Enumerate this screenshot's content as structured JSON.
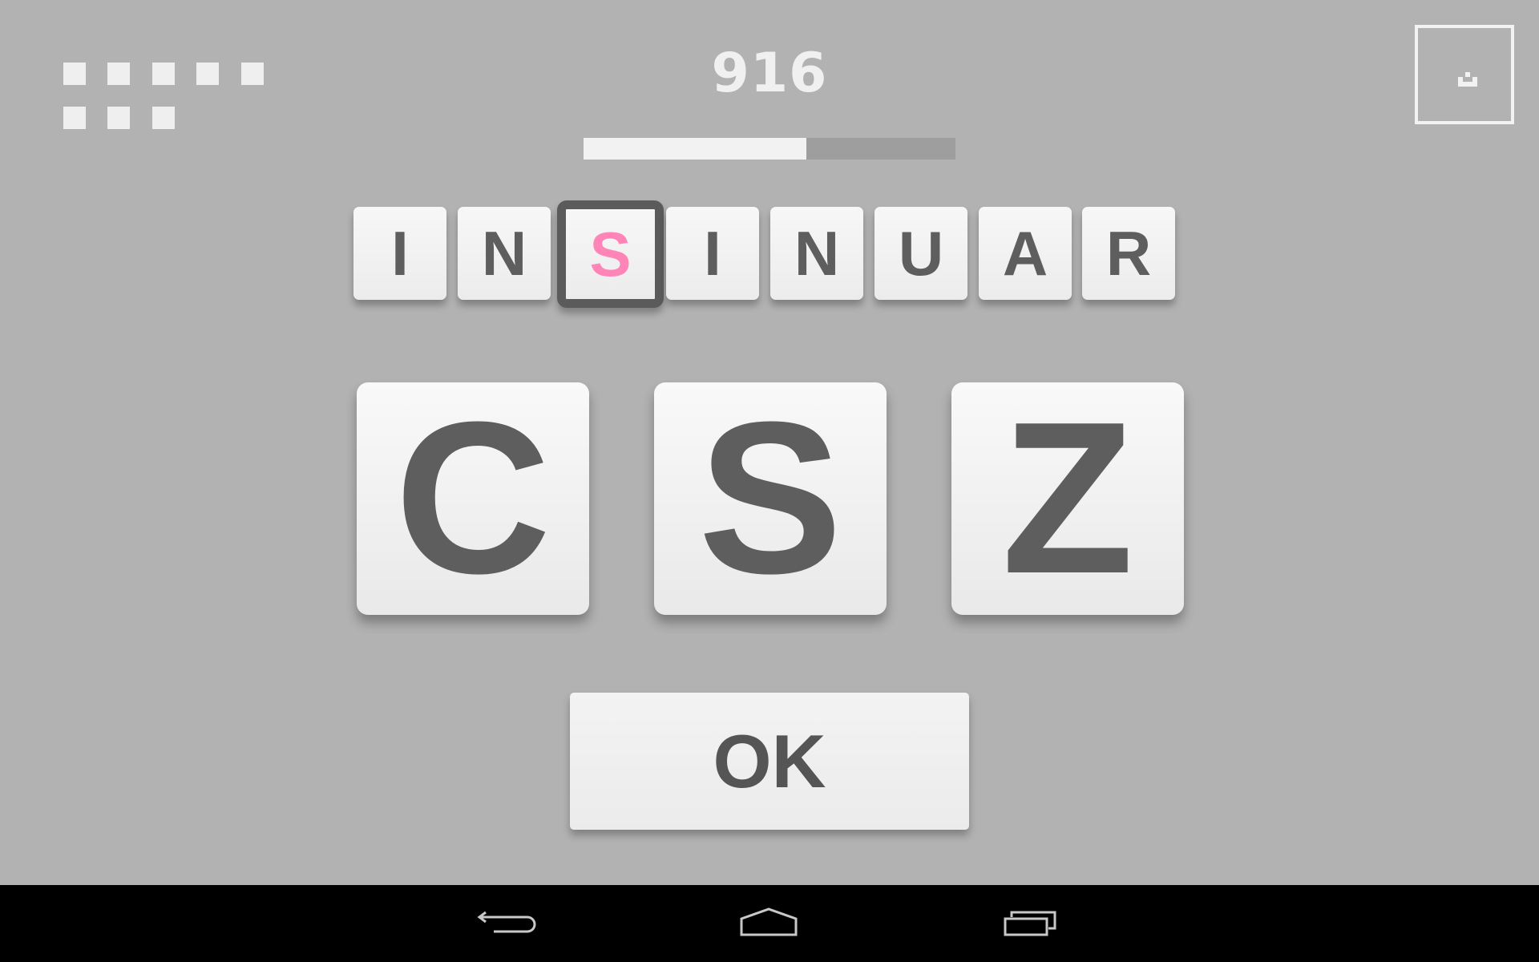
{
  "game": {
    "score": "916",
    "progress_fraction": 0.6,
    "lives_remaining": 8,
    "word_letters": [
      "I",
      "N",
      "S",
      "I",
      "N",
      "U",
      "A",
      "R"
    ],
    "selected_index": 2,
    "choices": [
      "C",
      "S",
      "Z"
    ],
    "ok_label": "OK"
  },
  "icons": {
    "menu": "menu-icon",
    "back": "back-icon",
    "home": "home-icon",
    "recents": "recent-apps-icon"
  },
  "colors": {
    "background": "#b2b2b2",
    "tile": "#f2f2f2",
    "letter": "#5e5e5e",
    "highlight_letter": "#ff85b8",
    "selected_border": "#5b5b5b"
  }
}
